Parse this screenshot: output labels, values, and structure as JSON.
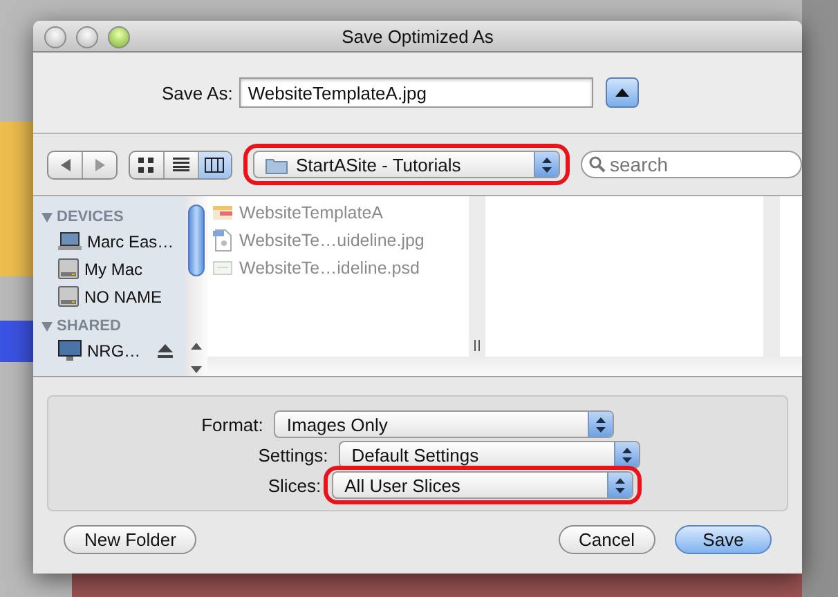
{
  "window": {
    "title": "Save Optimized As"
  },
  "save_as": {
    "label": "Save As:",
    "value": "WebsiteTemplateA.jpg"
  },
  "toolbar": {
    "view_modes": [
      {
        "kind": "icons",
        "selected": false
      },
      {
        "kind": "list",
        "selected": false
      },
      {
        "kind": "columns",
        "selected": true
      }
    ],
    "location": {
      "value": "StartASite - Tutorials",
      "highlighted": true
    },
    "search": {
      "placeholder": "search"
    }
  },
  "sidebar": [
    {
      "kind": "section",
      "label": "DEVICES"
    },
    {
      "kind": "laptop",
      "label": "Marc Eas…"
    },
    {
      "kind": "drive",
      "label": "My Mac"
    },
    {
      "kind": "drive",
      "label": "NO NAME"
    },
    {
      "kind": "section",
      "label": "SHARED"
    },
    {
      "kind": "monitor",
      "label": "NRG…",
      "eject": true
    }
  ],
  "files": [
    {
      "kind": "slice",
      "name": "WebsiteTemplateA"
    },
    {
      "kind": "jpg",
      "name": "WebsiteTe…uideline.jpg"
    },
    {
      "kind": "psd",
      "name": "WebsiteTe…ideline.psd"
    }
  ],
  "options": [
    {
      "label": "Format:",
      "value": "Images Only",
      "highlighted": false
    },
    {
      "label": "Settings:",
      "value": "Default Settings",
      "highlighted": false
    },
    {
      "label": "Slices:",
      "value": "All User Slices",
      "highlighted": true
    }
  ],
  "buttons": {
    "new_folder": "New Folder",
    "cancel": "Cancel",
    "save": "Save"
  }
}
